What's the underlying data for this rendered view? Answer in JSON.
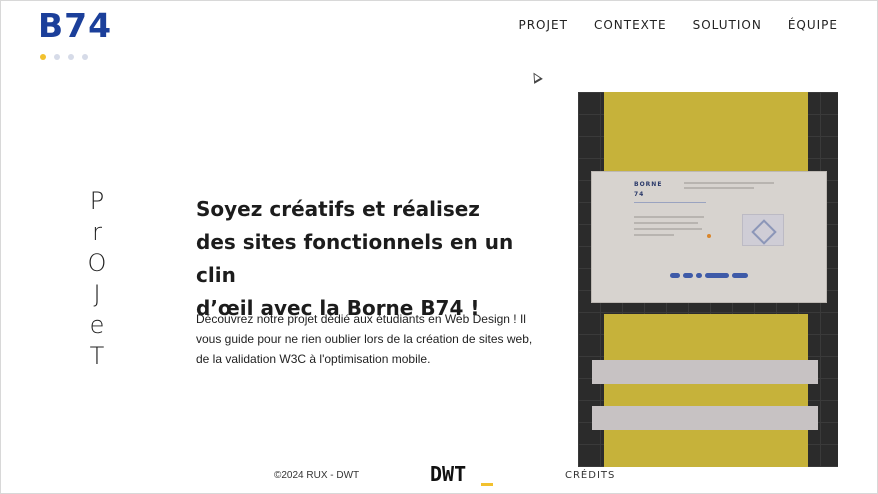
{
  "header": {
    "logo": "B74",
    "slides": [
      true,
      false,
      false,
      false
    ]
  },
  "nav": {
    "items": [
      "PROJET",
      "CONTEXTE",
      "SOLUTION",
      "ÉQUIPE"
    ]
  },
  "hero": {
    "vertical_label": [
      "P",
      "r",
      "O",
      "J",
      "e",
      "T"
    ],
    "headline_lines": [
      "Soyez créatifs et réalisez",
      "des sites fonctionnels en un clin",
      "d’œil avec la Borne B74 !"
    ],
    "description": "Découvrez notre projet dédié aux étudiants en Web Design ! Il vous guide pour ne rien oublier lors de la création de sites web, de la validation W3C à l'optimisation mobile."
  },
  "mockup": {
    "card_title": "BORNE 74",
    "colors": {
      "yellow": "#c6b23a",
      "dark": "#2b2b2b",
      "card": "#d7d3cf",
      "pill": "#3e5aa8"
    }
  },
  "footer": {
    "copyright": "©2024 RUX - DWT",
    "logo": "DWT",
    "credits": "CRÉDITS"
  },
  "colors": {
    "brand": "#1b3f9a",
    "accent": "#f2c12e"
  }
}
